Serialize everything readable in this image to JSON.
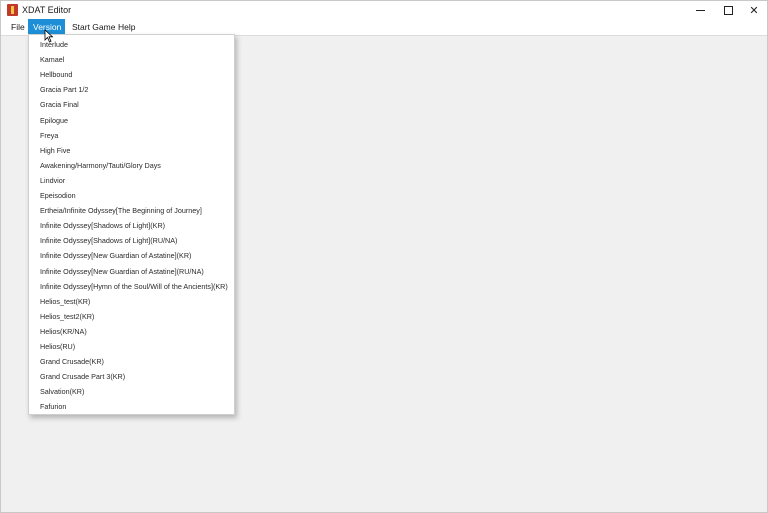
{
  "window": {
    "title": "XDAT Editor",
    "controls": {
      "minimize_icon": "minimize-icon",
      "maximize_icon": "maximize-icon",
      "close_label": "✕"
    }
  },
  "menubar": {
    "items": [
      {
        "label": "File"
      },
      {
        "label": "Version"
      },
      {
        "label": "Start Game"
      },
      {
        "label": "Help"
      }
    ],
    "active_color": "#1e8fd6"
  },
  "version_menu": {
    "items": [
      "Interlude",
      "Kamael",
      "Hellbound",
      "Gracia Part 1/2",
      "Gracia Final",
      "Epilogue",
      "Freya",
      "High Five",
      "Awakening/Harmony/Tauti/Glory Days",
      "Lindvior",
      "Epeisodion",
      "Ertheia/Infinite Odyssey[The Beginning of Journey]",
      "Infinite Odyssey[Shadows of Light](KR)",
      "Infinite Odyssey[Shadows of Light](RU/NA)",
      "Infinite Odyssey[New Guardian of Astatine](KR)",
      "Infinite Odyssey[New Guardian of Astatine](RU/NA)",
      "Infinite Odyssey[Hymn of the Soul/Will of the Ancients](KR)",
      "Helios_test(KR)",
      "Helios_test2(KR)",
      "Helios(KR/NA)",
      "Helios(RU)",
      "Grand Crusade(KR)",
      "Grand Crusade Part 3(KR)",
      "Salvation(KR)",
      "Fafurion"
    ]
  }
}
